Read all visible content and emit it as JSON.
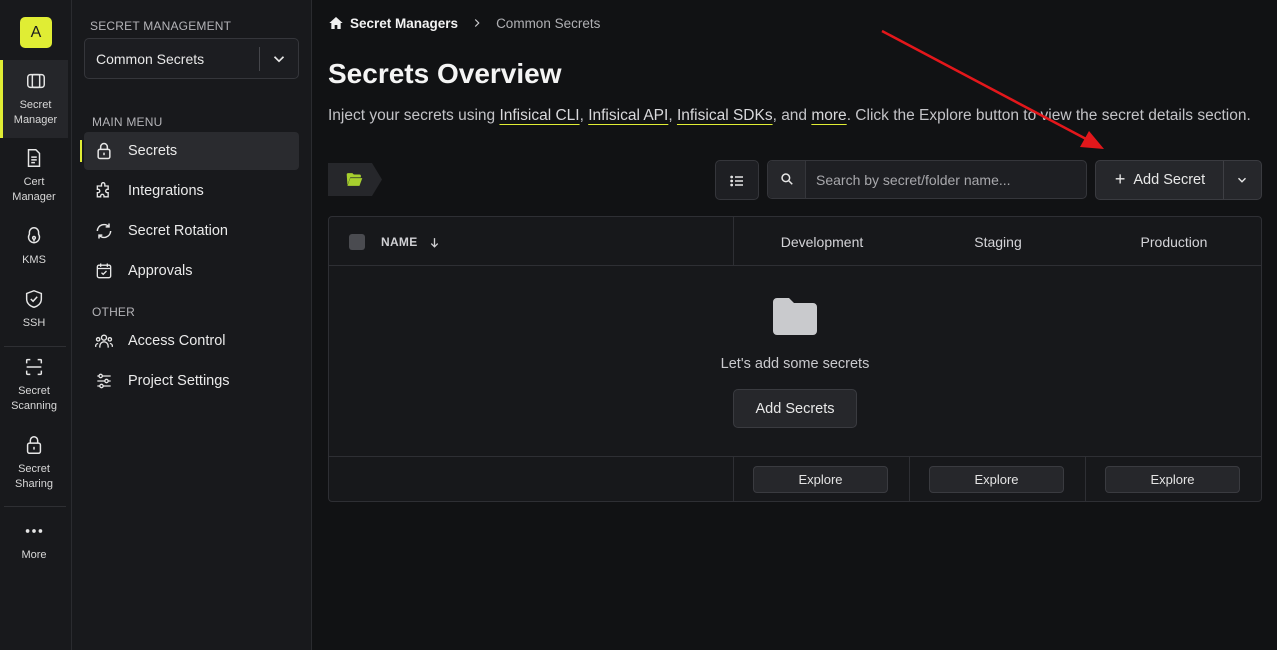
{
  "rail": {
    "avatar_letter": "A",
    "items": [
      {
        "icon": "secret-manager-icon",
        "line1": "Secret",
        "line2": "Manager"
      },
      {
        "icon": "cert-manager-icon",
        "line1": "Cert",
        "line2": "Manager"
      },
      {
        "icon": "kms-icon",
        "line1": "KMS",
        "line2": ""
      },
      {
        "icon": "ssh-icon",
        "line1": "SSH",
        "line2": ""
      },
      {
        "icon": "secret-scanning-icon",
        "line1": "Secret",
        "line2": "Scanning"
      },
      {
        "icon": "secret-sharing-icon",
        "line1": "Secret",
        "line2": "Sharing"
      },
      {
        "icon": "more-icon",
        "line1": "More",
        "line2": ""
      }
    ]
  },
  "sidebar": {
    "section_caption": "SECRET MANAGEMENT",
    "project_name": "Common Secrets",
    "main_menu_caption": "MAIN MENU",
    "main_menu": [
      {
        "icon": "lock-icon",
        "label": "Secrets"
      },
      {
        "icon": "puzzle-icon",
        "label": "Integrations"
      },
      {
        "icon": "rotation-icon",
        "label": "Secret Rotation"
      },
      {
        "icon": "approvals-icon",
        "label": "Approvals"
      }
    ],
    "other_caption": "OTHER",
    "other_menu": [
      {
        "icon": "users-icon",
        "label": "Access Control"
      },
      {
        "icon": "sliders-icon",
        "label": "Project Settings"
      }
    ]
  },
  "breadcrumb": {
    "root": "Secret Managers",
    "current": "Common Secrets"
  },
  "page": {
    "title": "Secrets Overview",
    "desc_prefix": "Inject your secrets using ",
    "link_cli": "Infisical CLI",
    "sep1": ", ",
    "link_api": "Infisical API",
    "sep2": ", ",
    "link_sdks": "Infisical SDKs",
    "sep3": ", and ",
    "link_more": "more",
    "desc_suffix": ". Click the Explore button to view the secret details section."
  },
  "toolbar": {
    "search_placeholder": "Search by secret/folder name...",
    "add_secret_label": "Add Secret"
  },
  "table": {
    "name_header": "NAME",
    "environments": [
      "Development",
      "Staging",
      "Production"
    ],
    "empty_text": "Let's add some secrets",
    "add_secrets_label": "Add Secrets",
    "explore_label": "Explore"
  },
  "colors": {
    "accent": "#e0ed34",
    "annotation_arrow": "#e3171b"
  }
}
